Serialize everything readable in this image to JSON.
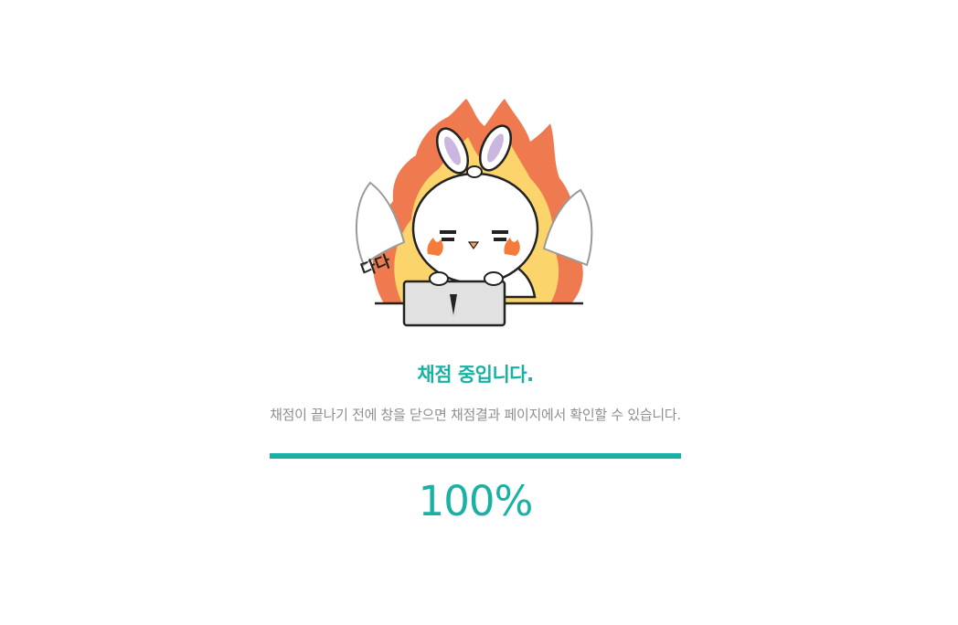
{
  "illustration": {
    "sound_effect_text": "다다",
    "description_icon": "bunny-on-fire-laptop-icon"
  },
  "status": {
    "title": "채점 중입니다.",
    "message": "채점이 끝나기 전에 창을 닫으면 채점결과 페이지에서 확인할 수 있습니다."
  },
  "progress": {
    "value": 1.0,
    "label": "100%"
  },
  "colors": {
    "accent": "#1ab1a5",
    "message": "#8e8e8e",
    "flame_outer": "#f07a4f",
    "flame_inner": "#fcd46c"
  }
}
